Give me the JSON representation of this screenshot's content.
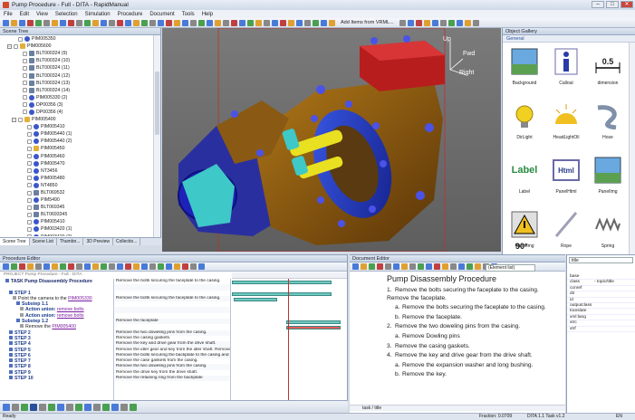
{
  "window": {
    "title": "Pump Procedure - Full - DITA - RapidManual",
    "min": "–",
    "max": "□",
    "close": "✕"
  },
  "menu": [
    "File",
    "Edit",
    "View",
    "Selection",
    "Simulation",
    "Procedure",
    "Document",
    "Tools",
    "Help"
  ],
  "toolbar": {
    "add_items_label": "Add Items from VRML..."
  },
  "scene_tree": {
    "title": "Scene Tree",
    "rows": [
      {
        "label": "PIM005350",
        "indent": 2,
        "expander": "",
        "icon": "part"
      },
      {
        "label": "PIM005600",
        "indent": 1,
        "expander": "−",
        "icon": "folder"
      },
      {
        "label": "BLT000324 (9)",
        "indent": 3,
        "expander": "",
        "icon": "bolt"
      },
      {
        "label": "BLT000324 (10)",
        "indent": 3,
        "expander": "",
        "icon": "bolt"
      },
      {
        "label": "BLT000324 (11)",
        "indent": 3,
        "expander": "",
        "icon": "bolt"
      },
      {
        "label": "BLT000324 (12)",
        "indent": 3,
        "expander": "",
        "icon": "bolt"
      },
      {
        "label": "BLT000324 (13)",
        "indent": 3,
        "expander": "",
        "icon": "bolt"
      },
      {
        "label": "BLT000324 (14)",
        "indent": 3,
        "expander": "",
        "icon": "bolt"
      },
      {
        "label": "PIM005330 (2)",
        "indent": 3,
        "expander": "",
        "icon": "part"
      },
      {
        "label": "DP00356 (3)",
        "indent": 3,
        "expander": "",
        "icon": "part"
      },
      {
        "label": "DP00356 (4)",
        "indent": 3,
        "expander": "",
        "icon": "part"
      },
      {
        "label": "PIM005400",
        "indent": 2,
        "expander": "−",
        "icon": "folder"
      },
      {
        "label": "PIM005410",
        "indent": 4,
        "expander": "",
        "icon": "part"
      },
      {
        "label": "PIM005440 (1)",
        "indent": 4,
        "expander": "",
        "icon": "part"
      },
      {
        "label": "PIM005440 (2)",
        "indent": 4,
        "expander": "",
        "icon": "part"
      },
      {
        "label": "PIM005450",
        "indent": 4,
        "expander": "",
        "icon": "folder"
      },
      {
        "label": "PIM005460",
        "indent": 4,
        "expander": "",
        "icon": "part"
      },
      {
        "label": "PIM005470",
        "indent": 4,
        "expander": "",
        "icon": "part"
      },
      {
        "label": "NT3456",
        "indent": 4,
        "expander": "",
        "icon": "part"
      },
      {
        "label": "PIM005480",
        "indent": 4,
        "expander": "",
        "icon": "part"
      },
      {
        "label": "NT4850",
        "indent": 4,
        "expander": "",
        "icon": "part"
      },
      {
        "label": "BLT069532",
        "indent": 4,
        "expander": "",
        "icon": "bolt"
      },
      {
        "label": "PIM5490",
        "indent": 4,
        "expander": "",
        "icon": "part"
      },
      {
        "label": "BLT069345",
        "indent": 4,
        "expander": "",
        "icon": "bolt"
      },
      {
        "label": "BLT0693345",
        "indent": 4,
        "expander": "",
        "icon": "bolt"
      },
      {
        "label": "PIM005410",
        "indent": 4,
        "expander": "",
        "icon": "part"
      },
      {
        "label": "PIM003420 (1)",
        "indent": 4,
        "expander": "",
        "icon": "part"
      },
      {
        "label": "PIM003420 (2)",
        "indent": 4,
        "expander": "",
        "icon": "part"
      },
      {
        "label": "PIM005430",
        "indent": 4,
        "expander": "",
        "icon": "part"
      }
    ],
    "tabs": [
      "Scene Tree",
      "Scene List",
      "Thumbn...",
      "3D Preview",
      "Collectio..."
    ]
  },
  "viewport": {
    "up": "Up",
    "fwd": "Fwd",
    "right": "Right"
  },
  "gallery": {
    "title": "Object Gallery",
    "section": "General",
    "items": [
      {
        "label": "Background",
        "icon": "background-icon"
      },
      {
        "label": "Callout",
        "icon": "callout-icon"
      },
      {
        "label": "dimension",
        "icon": "dimension-icon",
        "text": "0.5"
      },
      {
        "label": "DirLight",
        "icon": "dirlight-icon"
      },
      {
        "label": "HeadLightOil",
        "icon": "headlight-icon"
      },
      {
        "label": "Hose",
        "icon": "hose-icon"
      },
      {
        "label": "Label",
        "icon": "label-icon",
        "text": "Label"
      },
      {
        "label": "PanelHtml",
        "icon": "html-icon",
        "text": "Html"
      },
      {
        "label": "PanelImg",
        "icon": "panelimg-icon"
      },
      {
        "label": "PanelImg",
        "icon": "warning-icon"
      },
      {
        "label": "Rope",
        "icon": "rope-icon"
      },
      {
        "label": "Spring",
        "icon": "spring-icon"
      }
    ],
    "angle_text": "90°"
  },
  "procedure": {
    "title": "Procedure Editor",
    "project": "PROJECT Pump Procedure - Full - DITA",
    "lines": [
      {
        "kind": "task",
        "text": "TASK Pump Disassembly Procedure",
        "indent": 1
      },
      {
        "kind": "blank",
        "text": "",
        "indent": 0
      },
      {
        "kind": "step",
        "text": "STEP 1",
        "indent": 2
      },
      {
        "kind": "plain",
        "text": "Point the camera to the ",
        "link": "PIM005330",
        "indent": 3
      },
      {
        "kind": "step",
        "text": "Substep 1.1",
        "indent": 4
      },
      {
        "kind": "au",
        "text": "Action union: ",
        "link": "remove bolts",
        "indent": 5
      },
      {
        "kind": "au",
        "text": "Action union: ",
        "link": "remove bolts",
        "indent": 5
      },
      {
        "kind": "step",
        "text": "Substep 1.2",
        "indent": 4
      },
      {
        "kind": "plain",
        "text": "Remove the ",
        "link": "PIM005400",
        "indent": 5
      },
      {
        "kind": "step",
        "text": "STEP 2",
        "indent": 2
      },
      {
        "kind": "step",
        "text": "STEP 3",
        "indent": 2
      },
      {
        "kind": "step",
        "text": "STEP 4",
        "indent": 2
      },
      {
        "kind": "step",
        "text": "STEP 5",
        "indent": 2
      },
      {
        "kind": "step",
        "text": "STEP 6",
        "indent": 2
      },
      {
        "kind": "step",
        "text": "STEP 7",
        "indent": 2
      },
      {
        "kind": "step",
        "text": "STEP 8",
        "indent": 2
      },
      {
        "kind": "step",
        "text": "STEP 9",
        "indent": 2
      },
      {
        "kind": "step",
        "text": "STEP 10",
        "indent": 2
      }
    ],
    "descriptions": [
      "Remove the bolts securing the faceplate to the casing.",
      "",
      "",
      "Remove the bolts securing the faceplate to the casing.",
      "",
      "",
      "",
      "Remove the faceplate",
      "",
      "Remove the two doweling pins from the casing.",
      "Remove the casing gaskets.",
      "Remove the key and drive gear from the drive shaft.",
      "Remove the idler gear and key from the idler shaft. Remove the",
      "Remove the bolts securing the backplate to the casing and s",
      "Remove the case gaskets from the casing.",
      "Remove the two doweling pins from the casing.",
      "Remove the drive key from the drive shaft.",
      "Remove the retaining ring from the backplate"
    ]
  },
  "document": {
    "title": "Document Editor",
    "element_select": "(Element list)",
    "heading": "Pump Disassembly Procedure",
    "items": [
      {
        "type": "item",
        "n": "1.",
        "text": "Remove the bolts securing the faceplate to the casing. Remove the faceplate."
      },
      {
        "type": "sub",
        "n": "a.",
        "text": "Remove the bolts securing the faceplate to the casing."
      },
      {
        "type": "sub",
        "n": "b.",
        "text": "Remove the faceplate."
      },
      {
        "type": "item",
        "n": "2.",
        "text": "Remove the two doweling pins from the casing."
      },
      {
        "type": "sub",
        "n": "a.",
        "text": "Remove Dowling pins"
      },
      {
        "type": "item",
        "n": "3.",
        "text": "Remove the casing gaskets."
      },
      {
        "type": "item",
        "n": "4.",
        "text": "Remove the key and drive gear from the drive shaft."
      },
      {
        "type": "sub",
        "n": "a.",
        "text": "Remove the expansion washer and long bushing."
      },
      {
        "type": "sub",
        "n": "b.",
        "text": "Remove the key."
      }
    ],
    "path": "task / title"
  },
  "attributes": {
    "selected": "title",
    "rows": [
      {
        "k": "base",
        "v": ""
      },
      {
        "k": "class",
        "v": "- topic/title"
      },
      {
        "k": "conref",
        "v": ""
      },
      {
        "k": "dir",
        "v": ""
      },
      {
        "k": "id",
        "v": ""
      },
      {
        "k": "outputclass",
        "v": ""
      },
      {
        "k": "translate",
        "v": ""
      },
      {
        "k": "xml:lang",
        "v": ""
      },
      {
        "k": "xtrc",
        "v": ""
      },
      {
        "k": "xtrf",
        "v": ""
      }
    ]
  },
  "status": {
    "left": "Ready",
    "fraction": "Fraction: 0.0709",
    "task": "DITA 1.1 Task v1.2",
    "lang": "EN"
  },
  "colors": {
    "accent": "#2a4f9a",
    "link": "#7a1aa0",
    "gantt_bar": "#6fc8c0",
    "gantt_active": "#e85a5a"
  }
}
